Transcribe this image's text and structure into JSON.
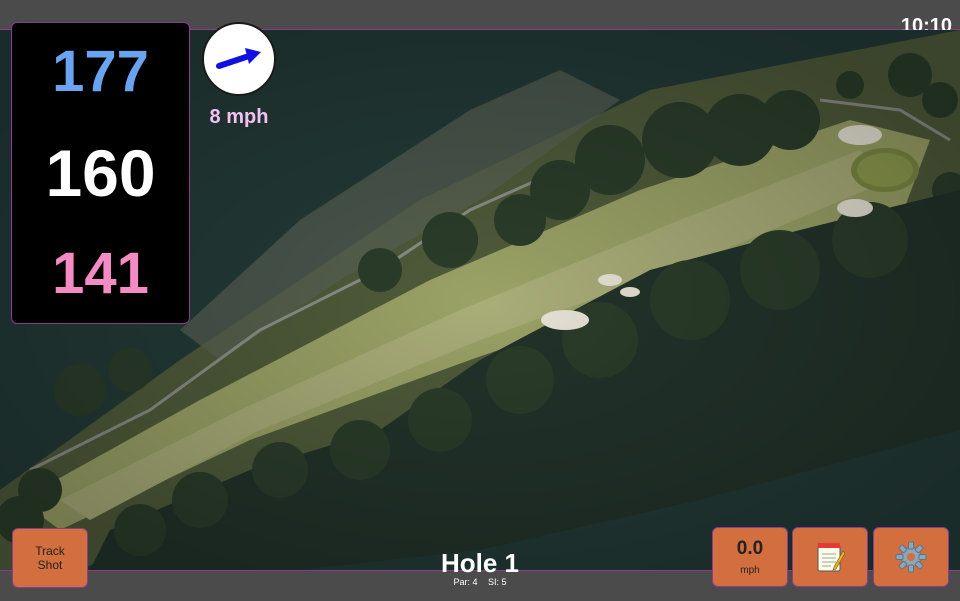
{
  "status_bar": {
    "time": "10:10"
  },
  "yardage": {
    "back": "177",
    "center": "160",
    "front": "141"
  },
  "wind": {
    "speed": "8 mph",
    "icon": "wind-arrow-icon",
    "arrow_color": "#1010e0"
  },
  "hole": {
    "title": "Hole 1",
    "par": "Par: 4",
    "stroke_index": "SI: 5"
  },
  "buttons": {
    "track_shot": {
      "line1": "Track",
      "line2": "Shot"
    },
    "speed": {
      "value": "0.0",
      "unit": "mph"
    },
    "notes": {
      "icon": "notepad-icon"
    },
    "settings": {
      "icon": "gear-icon"
    }
  },
  "colors": {
    "button_bg": "#d36f3f",
    "accent_border": "#8a3d8f",
    "back_yardage": "#6aa3ef",
    "front_yardage": "#f58bc4",
    "fairway": "#9aa266",
    "trees": "#2b3d2a",
    "bunker": "#e8e4d6"
  }
}
